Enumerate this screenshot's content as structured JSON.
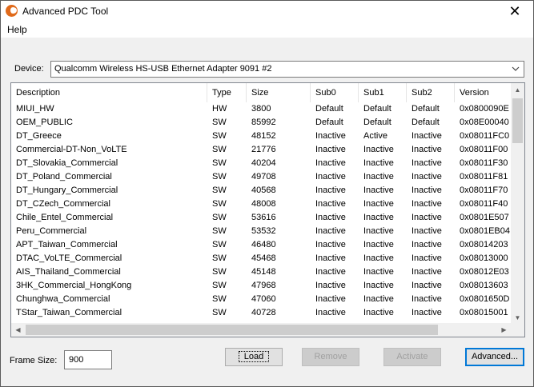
{
  "window": {
    "title": "Advanced PDC Tool",
    "close_glyph": "✕"
  },
  "menu": {
    "items": [
      "Help"
    ]
  },
  "device": {
    "label": "Device:",
    "selected": "Qualcomm Wireless HS-USB Ethernet Adapter 9091 #2"
  },
  "table": {
    "columns": [
      "Description",
      "Type",
      "Size",
      "Sub0",
      "Sub1",
      "Sub2",
      "Version"
    ],
    "rows": [
      [
        "MIUI_HW",
        "HW",
        "3800",
        "Default",
        "Default",
        "Default",
        "0x0800090E"
      ],
      [
        "OEM_PUBLIC",
        "SW",
        "85992",
        "Default",
        "Default",
        "Default",
        "0x08E00040"
      ],
      [
        "DT_Greece",
        "SW",
        "48152",
        "Inactive",
        "Active",
        "Inactive",
        "0x08011FC0"
      ],
      [
        "Commercial-DT-Non_VoLTE",
        "SW",
        "21776",
        "Inactive",
        "Inactive",
        "Inactive",
        "0x08011F00"
      ],
      [
        "DT_Slovakia_Commercial",
        "SW",
        "40204",
        "Inactive",
        "Inactive",
        "Inactive",
        "0x08011F30"
      ],
      [
        "DT_Poland_Commercial",
        "SW",
        "49708",
        "Inactive",
        "Inactive",
        "Inactive",
        "0x08011F81"
      ],
      [
        "DT_Hungary_Commercial",
        "SW",
        "40568",
        "Inactive",
        "Inactive",
        "Inactive",
        "0x08011F70"
      ],
      [
        "DT_CZech_Commercial",
        "SW",
        "48008",
        "Inactive",
        "Inactive",
        "Inactive",
        "0x08011F40"
      ],
      [
        "Chile_Entel_Commercial",
        "SW",
        "53616",
        "Inactive",
        "Inactive",
        "Inactive",
        "0x0801E507"
      ],
      [
        "Peru_Commercial",
        "SW",
        "53532",
        "Inactive",
        "Inactive",
        "Inactive",
        "0x0801EB04"
      ],
      [
        "APT_Taiwan_Commercial",
        "SW",
        "46480",
        "Inactive",
        "Inactive",
        "Inactive",
        "0x08014203"
      ],
      [
        "DTAC_VoLTE_Commercial",
        "SW",
        "45468",
        "Inactive",
        "Inactive",
        "Inactive",
        "0x08013000"
      ],
      [
        "AIS_Thailand_Commercial",
        "SW",
        "45148",
        "Inactive",
        "Inactive",
        "Inactive",
        "0x08012E03"
      ],
      [
        "3HK_Commercial_HongKong",
        "SW",
        "47968",
        "Inactive",
        "Inactive",
        "Inactive",
        "0x08013603"
      ],
      [
        "Chunghwa_Commercial",
        "SW",
        "47060",
        "Inactive",
        "Inactive",
        "Inactive",
        "0x0801650D"
      ],
      [
        "TStar_Taiwan_Commercial",
        "SW",
        "40728",
        "Inactive",
        "Inactive",
        "Inactive",
        "0x08015001"
      ]
    ]
  },
  "frame_size": {
    "label": "Frame Size:",
    "value": "900"
  },
  "buttons": {
    "load": "Load",
    "remove": "Remove",
    "activate": "Activate",
    "advanced": "Advanced..."
  },
  "colors": {
    "accent": "#0078d7",
    "app_icon": "#e06a1b",
    "window_bg": "#f0f0f0"
  }
}
